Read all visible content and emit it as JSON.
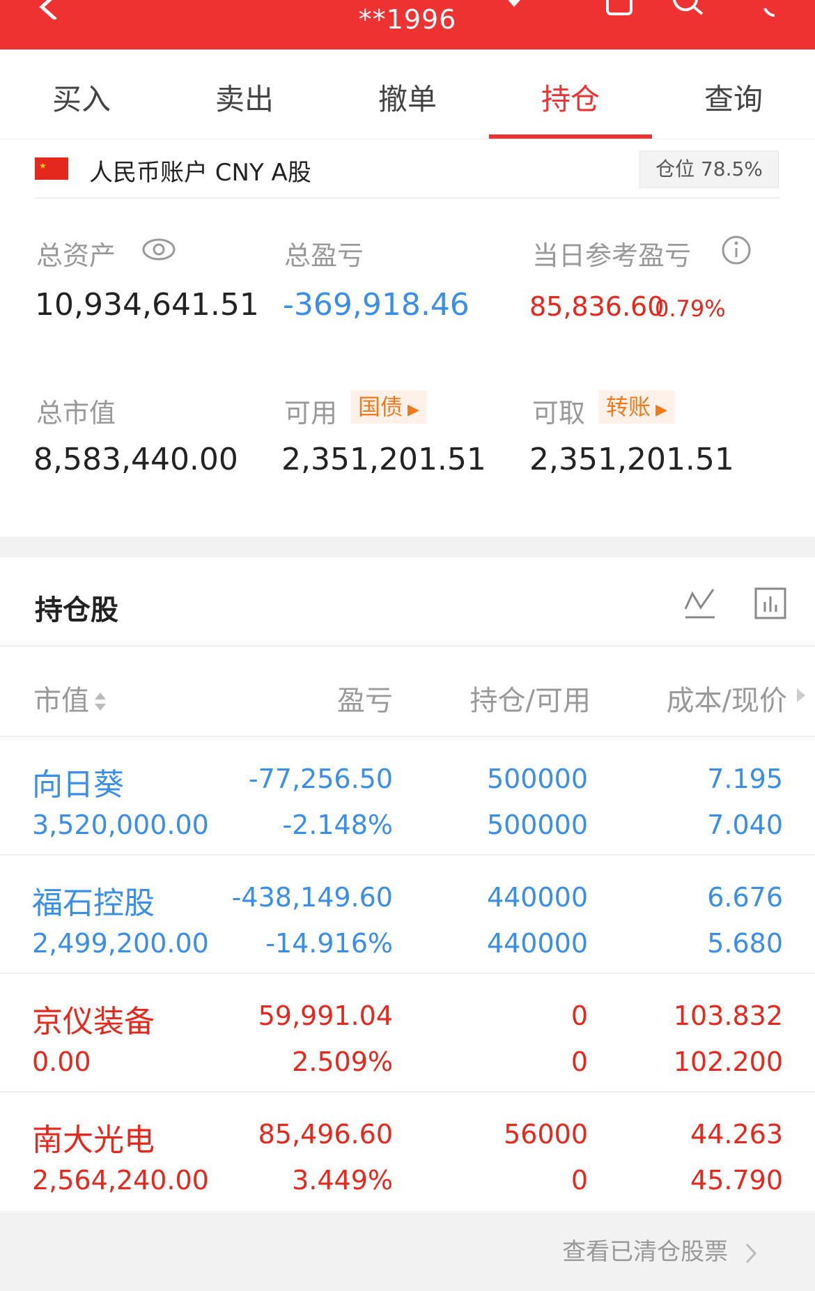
{
  "header": {
    "title": "**1996"
  },
  "tabs": [
    {
      "label": "买入"
    },
    {
      "label": "卖出"
    },
    {
      "label": "撤单"
    },
    {
      "label": "持仓"
    },
    {
      "label": "查询"
    }
  ],
  "account": {
    "name": "人民币账户 CNY A股",
    "position_label": "仓位 78.5%"
  },
  "summary": {
    "total_assets_label": "总资产",
    "total_assets": "10,934,641.51",
    "total_pnl_label": "总盈亏",
    "total_pnl": "-369,918.46",
    "daily_pnl_label": "当日参考盈亏",
    "daily_pnl": "85,836.60",
    "daily_pnl_pct": "0.79%",
    "market_value_label": "总市值",
    "market_value": "8,583,440.00",
    "available_label": "可用",
    "available_btn": "国债",
    "available": "2,351,201.51",
    "withdrawable_label": "可取",
    "withdrawable_btn": "转账",
    "withdrawable": "2,351,201.51"
  },
  "holdings": {
    "title": "持仓股",
    "columns": {
      "market_value": "市值",
      "pnl": "盈亏",
      "position": "持仓/可用",
      "cost_price": "成本/现价"
    },
    "rows": [
      {
        "name": "向日葵",
        "market_value": "3,520,000.00",
        "pnl": "-77,256.50",
        "pnl_pct": "-2.148%",
        "position": "500000",
        "available": "500000",
        "cost": "7.195",
        "price": "7.040",
        "color": "#3a8ee6"
      },
      {
        "name": "福石控股",
        "market_value": "2,499,200.00",
        "pnl": "-438,149.60",
        "pnl_pct": "-14.916%",
        "position": "440000",
        "available": "440000",
        "cost": "6.676",
        "price": "5.680",
        "color": "#3a8ee6"
      },
      {
        "name": "京仪装备",
        "market_value": "0.00",
        "pnl": "59,991.04",
        "pnl_pct": "2.509%",
        "position": "0",
        "available": "0",
        "cost": "103.832",
        "price": "102.200",
        "color": "#e5281e"
      },
      {
        "name": "南大光电",
        "market_value": "2,564,240.00",
        "pnl": "85,496.60",
        "pnl_pct": "3.449%",
        "position": "56000",
        "available": "0",
        "cost": "44.263",
        "price": "45.790",
        "color": "#e5281e"
      }
    ]
  },
  "footer": {
    "cleared_link": "查看已清仓股票"
  }
}
